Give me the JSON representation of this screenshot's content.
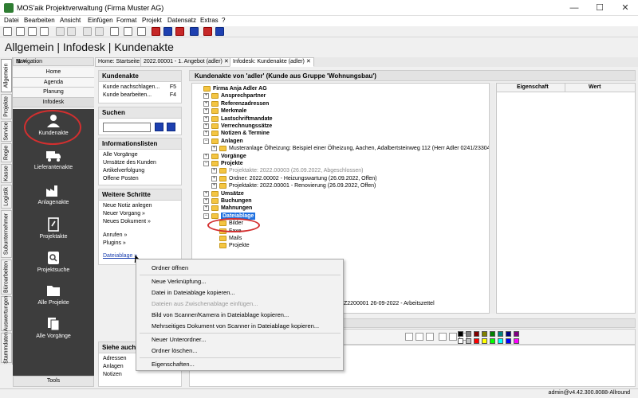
{
  "window": {
    "title": "MOS'aik Projektverwaltung (Firma Muster AG)",
    "minimize": "—",
    "maximize": "☐",
    "close": "✕"
  },
  "menu": [
    "Datei",
    "Bearbeiten",
    "Ansicht",
    "Einfügen",
    "Format",
    "Projekt",
    "Datensatz",
    "Extras",
    "?"
  ],
  "breadcrumb": "Allgemein | Infodesk | Kundenakte",
  "navigation": {
    "header": "Navigation",
    "pins": "⊞ ✕",
    "vertical_tabs": [
      "Allgemein",
      "Projekte",
      "Service",
      "Regie",
      "Kasse",
      "Logistik",
      "Subunternehmer",
      "Büroarbeiten",
      "Auswertungen",
      "Stammdaten"
    ],
    "items": [
      "Home",
      "Agenda",
      "Planung",
      "Infodesk"
    ],
    "big_items": [
      "Kundenakte",
      "Lieferantenakte",
      "Anlagenakte",
      "Projektakte",
      "Projektsuche",
      "Alle Projekte",
      "Alle Vorgänge"
    ],
    "tools": "Tools"
  },
  "tabs": [
    "Home: Startseite",
    "2022.00001 - 1. Angebot (adler)",
    "Infodesk: Kundenakte (adler)"
  ],
  "tab_close": "✕",
  "sidebar": {
    "kundenakte": {
      "title": "Kundenakte",
      "items": [
        {
          "label": "Kunde nachschlagen...",
          "key": "F5"
        },
        {
          "label": "Kunde bearbeiten...",
          "key": "F4"
        }
      ]
    },
    "suchen": {
      "title": "Suchen"
    },
    "info": {
      "title": "Informationslisten",
      "items": [
        "Alle Vorgänge",
        "Umsätze des Kunden",
        "Artikelverfolgung",
        "Offene Posten"
      ]
    },
    "weitere": {
      "title": "Weitere Schritte",
      "items": [
        "Neue Notiz anlegen",
        "Neuer Vorgang »",
        "Neues Dokument »",
        "Anrufen »",
        "Plugins »",
        "Dateiablage »"
      ]
    },
    "siehe": {
      "title": "Siehe auch",
      "items": [
        "Adressen",
        "Anlagen",
        "Notizen"
      ]
    }
  },
  "main": {
    "title": "Kundenakte von 'adler' (Kunde aus Gruppe 'Wohnungsbau')",
    "tree": [
      {
        "label": "Firma Anja Adler AG",
        "bold": true,
        "level": 0,
        "exp": ""
      },
      {
        "label": "Ansprechpartner",
        "bold": true,
        "level": 1,
        "exp": "+"
      },
      {
        "label": "Referenzadressen",
        "bold": true,
        "level": 1,
        "exp": "+"
      },
      {
        "label": "Merkmale",
        "bold": true,
        "level": 1,
        "exp": "+"
      },
      {
        "label": "Lastschriftmandate",
        "bold": true,
        "level": 1,
        "exp": "+"
      },
      {
        "label": "Verrechnungssätze",
        "bold": true,
        "level": 1,
        "exp": "+"
      },
      {
        "label": "Notizen & Termine",
        "bold": true,
        "level": 1,
        "exp": "+"
      },
      {
        "label": "Anlagen",
        "bold": true,
        "level": 1,
        "exp": "−"
      },
      {
        "label": "Musteranlage Ölheizung: Beispiel einer Ölheizung, Aachen, Adalbertsteinweg 112 (Herr Adler 0241/23304)",
        "level": 2,
        "exp": "+"
      },
      {
        "label": "Vorgänge",
        "bold": true,
        "level": 1,
        "exp": "+"
      },
      {
        "label": "Projekte",
        "bold": true,
        "level": 1,
        "exp": "−"
      },
      {
        "label": "Projektakte: 2022.00003 (26.09.2022, Abgeschlossen)",
        "level": 2,
        "exp": "+",
        "grey": true
      },
      {
        "label": "Ordner: 2022.00002 - Heizungswartung (26.09.2022, Offen)",
        "level": 2,
        "exp": "+"
      },
      {
        "label": "Projektakte: 2022.00001 - Renovierung (26.09.2022, Offen)",
        "level": 2,
        "exp": "+"
      },
      {
        "label": "Umsätze",
        "bold": true,
        "level": 1,
        "exp": "+"
      },
      {
        "label": "Buchungen",
        "bold": true,
        "level": 1,
        "exp": "+"
      },
      {
        "label": "Mahnungen",
        "bold": true,
        "level": 1,
        "exp": "+"
      },
      {
        "label": "Dateiablage",
        "bold": true,
        "level": 1,
        "exp": "−",
        "highlight": true
      },
      {
        "label": "Bilder",
        "level": 2,
        "exp": ""
      },
      {
        "label": "Faxe",
        "level": 2,
        "exp": ""
      },
      {
        "label": "Mails",
        "level": 2,
        "exp": ""
      },
      {
        "label": "Projekte",
        "level": 2,
        "exp": ""
      }
    ],
    "partial_row": "Z2200001 26-09-2022 - Arbeitszettel",
    "props_headers": [
      "Eigenschaft",
      "Wert"
    ]
  },
  "context_menu": [
    {
      "label": "Ordner öffnen",
      "disabled": false
    },
    {
      "label": "Neue Verknüpfung...",
      "disabled": false
    },
    {
      "label": "Datei in Dateiablage kopieren...",
      "disabled": false
    },
    {
      "label": "Dateien aus Zwischenablage einfügen...",
      "disabled": true
    },
    {
      "label": "Bild von Scanner/Kamera in Dateiablage kopieren...",
      "disabled": false
    },
    {
      "label": "Mehrseitiges Dokument von Scanner in Dateiablage kopieren...",
      "disabled": false
    },
    {
      "label": "Neuer Unterordner...",
      "disabled": false
    },
    {
      "label": "Ordner löschen...",
      "disabled": false
    },
    {
      "label": "Eigenschaften...",
      "disabled": false
    }
  ],
  "status": "admin@v4.42.300.8088-Allround",
  "colors": {
    "selection": "#1e70e0",
    "nav_bg": "#3d3d3d",
    "annotation": "#d32f2f",
    "folder": "#f4c542"
  }
}
